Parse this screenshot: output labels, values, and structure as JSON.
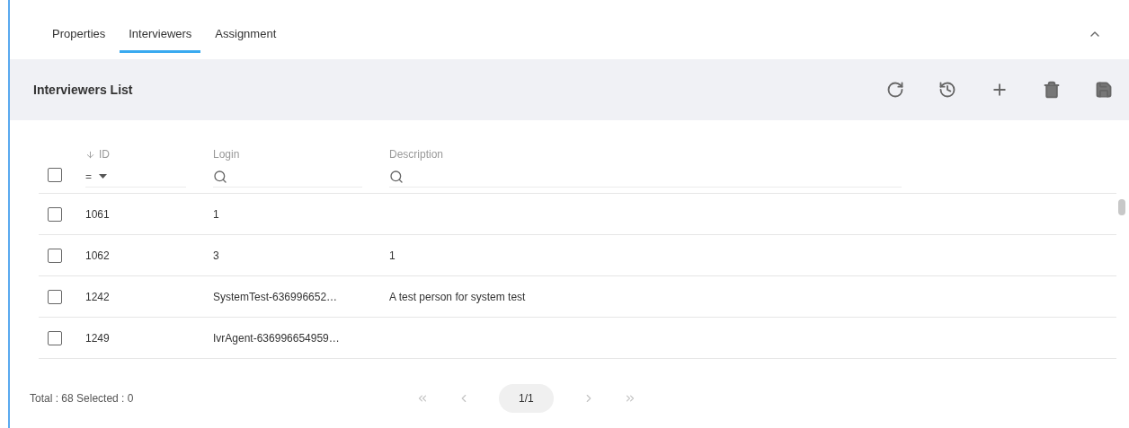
{
  "tabs": [
    {
      "label": "Properties",
      "selected": false
    },
    {
      "label": "Interviewers",
      "selected": true
    },
    {
      "label": "Assignment",
      "selected": false
    }
  ],
  "panel": {
    "expanded": true
  },
  "toolbar": {
    "title": "Interviewers List",
    "actions": [
      {
        "kind": "refresh"
      },
      {
        "kind": "history"
      },
      {
        "kind": "add"
      },
      {
        "kind": "delete"
      },
      {
        "kind": "save"
      }
    ]
  },
  "table": {
    "all_checked": false,
    "columns": [
      {
        "label": "ID",
        "sorted_descending": true,
        "kind": "operator",
        "operator": "="
      },
      {
        "label": "Login",
        "sorted_descending": false,
        "kind": "search"
      },
      {
        "label": "Description",
        "sorted_descending": false,
        "kind": "search"
      }
    ],
    "rows": [
      {
        "checked": false,
        "cells": [
          "1061",
          "1",
          ""
        ]
      },
      {
        "checked": false,
        "cells": [
          "1062",
          "3",
          "1"
        ]
      },
      {
        "checked": false,
        "cells": [
          "1242",
          "SystemTest-636996652…",
          "A test person for system test"
        ]
      },
      {
        "checked": false,
        "cells": [
          "1249",
          "IvrAgent-636996654959…",
          ""
        ]
      }
    ]
  },
  "footer": {
    "summary": "Total : 68 Selected : 0",
    "pager": {
      "page": "1/1",
      "buttons": [
        {
          "kind": "first",
          "disabled": true
        },
        {
          "kind": "previous",
          "disabled": true
        },
        {
          "kind": "next",
          "disabled": true
        },
        {
          "kind": "last",
          "disabled": true
        }
      ]
    }
  }
}
